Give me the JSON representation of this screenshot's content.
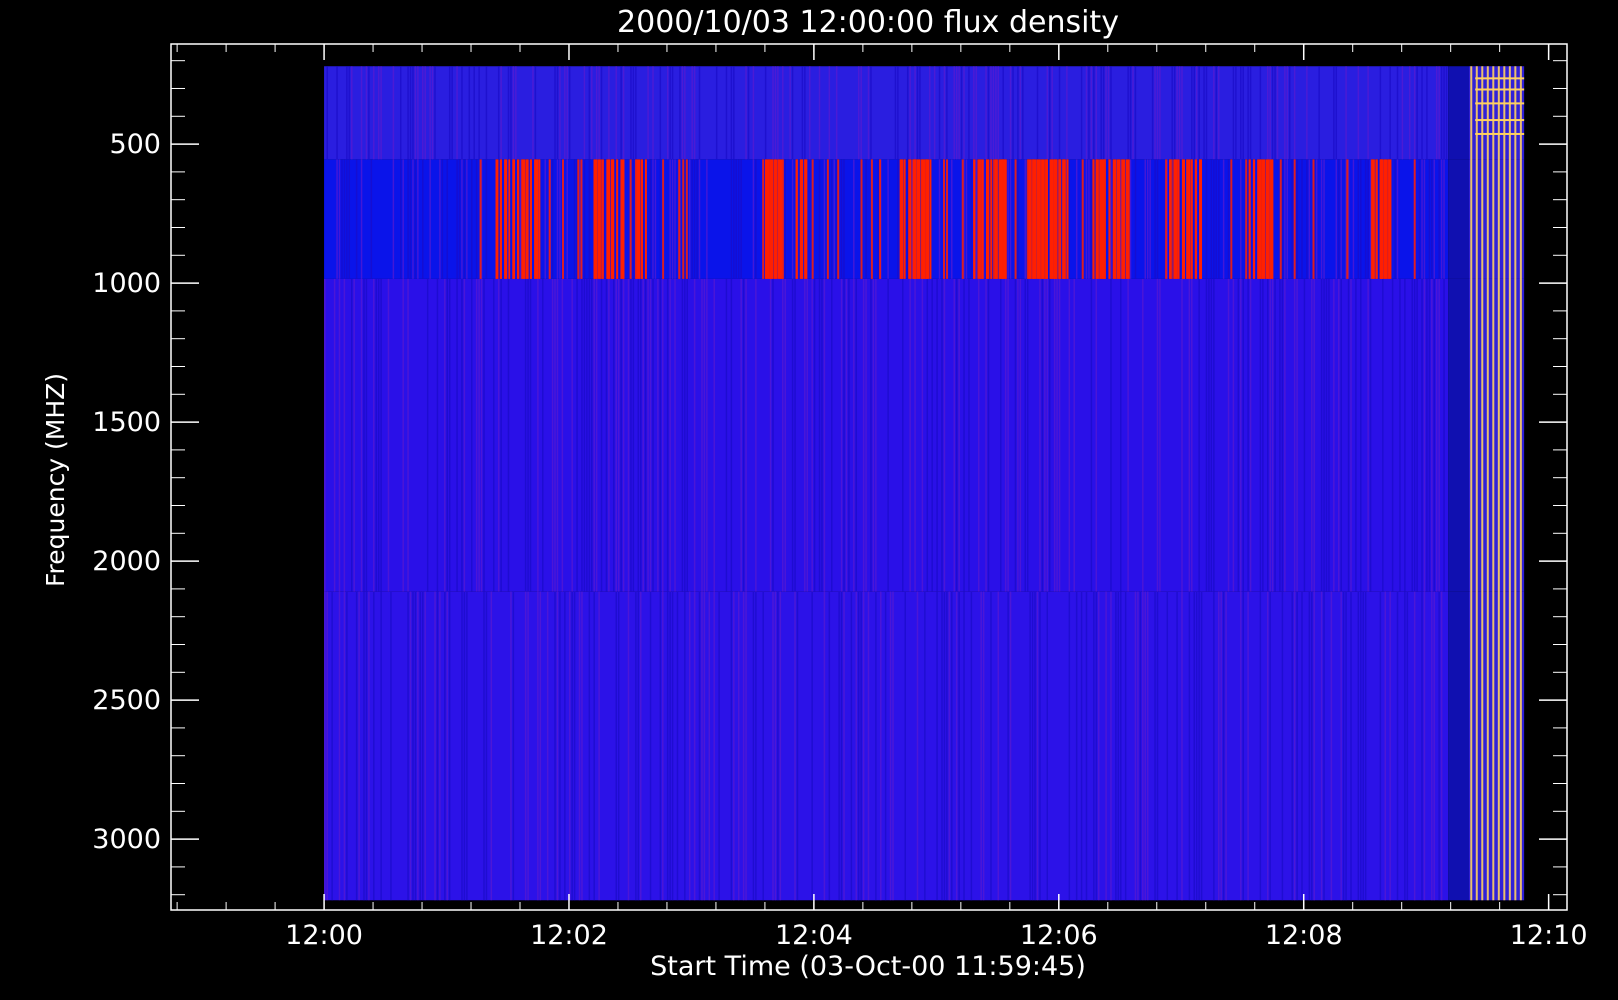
{
  "chart_data": {
    "type": "heatmap",
    "title": "2000/10/03 12:00:00 flux density",
    "xlabel": "Start Time (03-Oct-00 11:59:45)",
    "ylabel": "Frequency (MHZ)",
    "x_tick_labels": [
      "12:00",
      "12:02",
      "12:04",
      "12:06",
      "12:08",
      "12:10"
    ],
    "x_tick_values_min": [
      0,
      2,
      4,
      6,
      8,
      10
    ],
    "xlim_min": [
      -1.25,
      10.15
    ],
    "y_tick_labels": [
      "500",
      "1000",
      "1500",
      "2000",
      "2500",
      "3000"
    ],
    "y_tick_values": [
      500,
      1000,
      1500,
      2000,
      2500,
      3000
    ],
    "ylim": [
      3255,
      140
    ],
    "y_minor_step": 100,
    "x_minor_step_min": 0.4,
    "data_extent": {
      "t_start_min": 0,
      "t_end_min": 9.8,
      "f_min": 220,
      "f_max": 3220
    },
    "bands": [
      {
        "name": "",
        "f_from": 220,
        "f_to": 555,
        "base_color": "#2a1ee0"
      },
      {
        "name": "",
        "f_from": 555,
        "f_to": 985,
        "base_color": "#0a14ea"
      },
      {
        "name": "",
        "f_from": 985,
        "f_to": 2110,
        "base_color": "#2a10e8"
      },
      {
        "name": "",
        "f_from": 2110,
        "f_to": 3220,
        "base_color": "#2c12e8"
      }
    ],
    "burst_bursts_min": [
      [
        1.4,
        1.75
      ],
      [
        2.2,
        2.35
      ],
      [
        2.35,
        2.45
      ],
      [
        2.55,
        2.65
      ],
      [
        3.6,
        3.75
      ],
      [
        3.85,
        3.95
      ],
      [
        4.7,
        4.95
      ],
      [
        5.3,
        5.55
      ],
      [
        5.75,
        6.1
      ],
      [
        6.3,
        6.55
      ],
      [
        6.9,
        7.15
      ],
      [
        7.55,
        7.75
      ],
      [
        8.55,
        8.7
      ]
    ],
    "colors": {
      "low": "#0000ff",
      "high": "#ff2000",
      "peak": "#ffd060",
      "background": "#000000"
    }
  }
}
